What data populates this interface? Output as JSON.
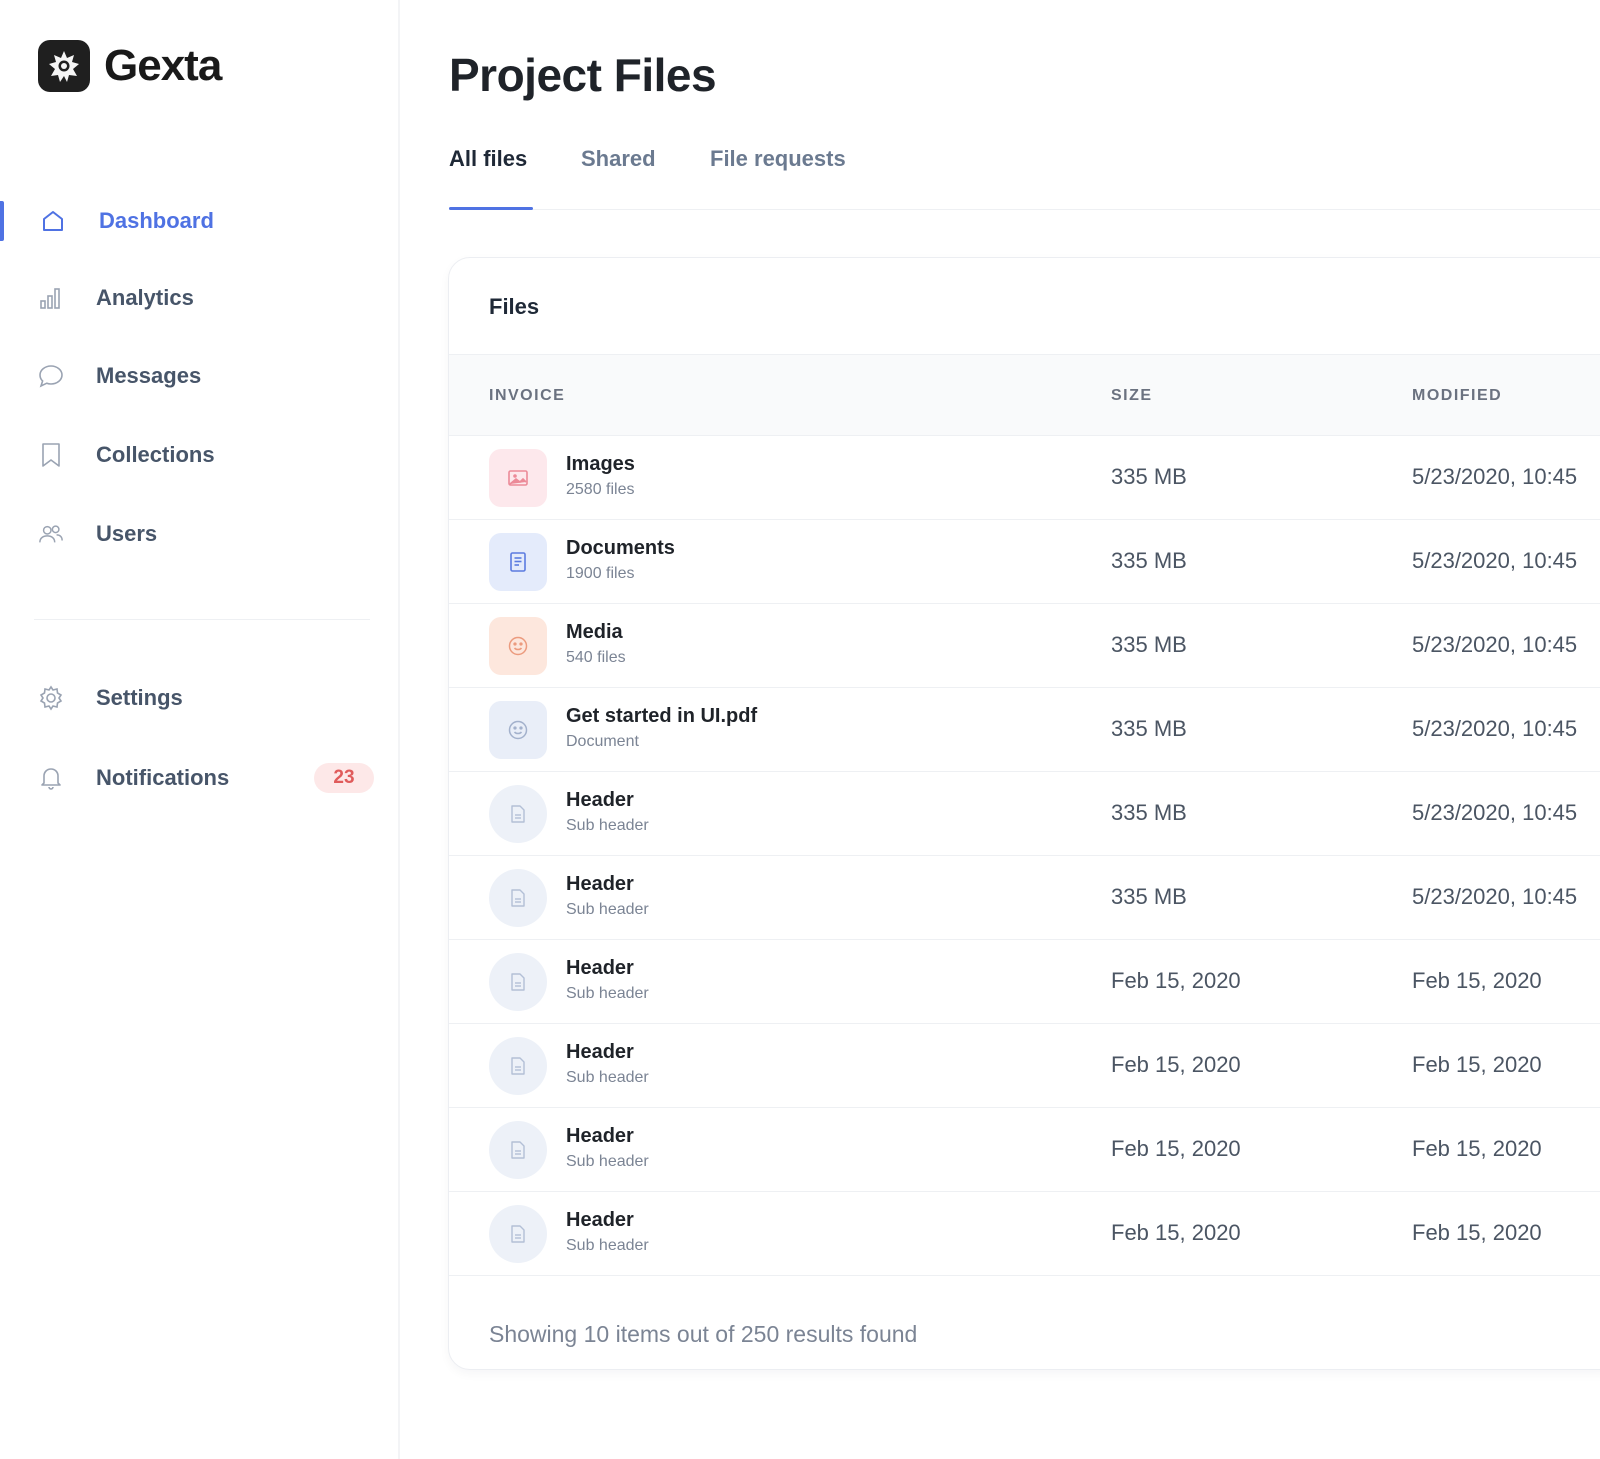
{
  "brand": {
    "name": "Gexta"
  },
  "sidebar": {
    "items": [
      {
        "label": "Dashboard",
        "icon": "home-icon",
        "active": true
      },
      {
        "label": "Analytics",
        "icon": "bar-chart-icon",
        "active": false
      },
      {
        "label": "Messages",
        "icon": "chat-bubble-icon",
        "active": false
      },
      {
        "label": "Collections",
        "icon": "bookmark-icon",
        "active": false
      },
      {
        "label": "Users",
        "icon": "users-icon",
        "active": false
      }
    ],
    "secondary": [
      {
        "label": "Settings",
        "icon": "gear-icon"
      },
      {
        "label": "Notifications",
        "icon": "bell-icon",
        "badge": "23"
      }
    ]
  },
  "page": {
    "title": "Project Files"
  },
  "tabs": [
    {
      "label": "All files",
      "active": true
    },
    {
      "label": "Shared",
      "active": false
    },
    {
      "label": "File requests",
      "active": false
    }
  ],
  "files_card": {
    "title": "Files",
    "columns": [
      "INVOICE",
      "SIZE",
      "MODIFIED"
    ],
    "rows": [
      {
        "name": "Images",
        "sub": "2580 files",
        "size": "335 MB",
        "modified": "5/23/2020, 10:45",
        "icon": "image-icon"
      },
      {
        "name": "Documents",
        "sub": "1900 files",
        "size": "335 MB",
        "modified": "5/23/2020, 10:45",
        "icon": "document-icon"
      },
      {
        "name": "Media",
        "sub": "540 files",
        "size": "335 MB",
        "modified": "5/23/2020, 10:45",
        "icon": "smiley-icon"
      },
      {
        "name": "Get started in UI.pdf",
        "sub": "Document",
        "size": "335 MB",
        "modified": "5/23/2020, 10:45",
        "icon": "smiley-icon"
      },
      {
        "name": "Header",
        "sub": "Sub header",
        "size": "335 MB",
        "modified": "5/23/2020, 10:45",
        "icon": "file-icon"
      },
      {
        "name": "Header",
        "sub": "Sub header",
        "size": "335 MB",
        "modified": "5/23/2020, 10:45",
        "icon": "file-icon"
      },
      {
        "name": "Header",
        "sub": "Sub header",
        "size": "Feb 15, 2020",
        "modified": "Feb 15, 2020",
        "icon": "file-icon"
      },
      {
        "name": "Header",
        "sub": "Sub header",
        "size": "Feb 15, 2020",
        "modified": "Feb 15, 2020",
        "icon": "file-icon"
      },
      {
        "name": "Header",
        "sub": "Sub header",
        "size": "Feb 15, 2020",
        "modified": "Feb 15, 2020",
        "icon": "file-icon"
      },
      {
        "name": "Header",
        "sub": "Sub header",
        "size": "Feb 15, 2020",
        "modified": "Feb 15, 2020",
        "icon": "file-icon"
      }
    ],
    "footer": "Showing 10 items out of 250 results found"
  },
  "colors": {
    "accent": "#4f72e3",
    "badge_bg": "#fde8e8",
    "badge_text": "#e05b5b",
    "images_bg": "#fde8ec",
    "documents_bg": "#e4ebfb",
    "media_bg": "#fde7dd",
    "pdf_bg": "#e9eef8",
    "file_bg": "#edf1f8"
  }
}
